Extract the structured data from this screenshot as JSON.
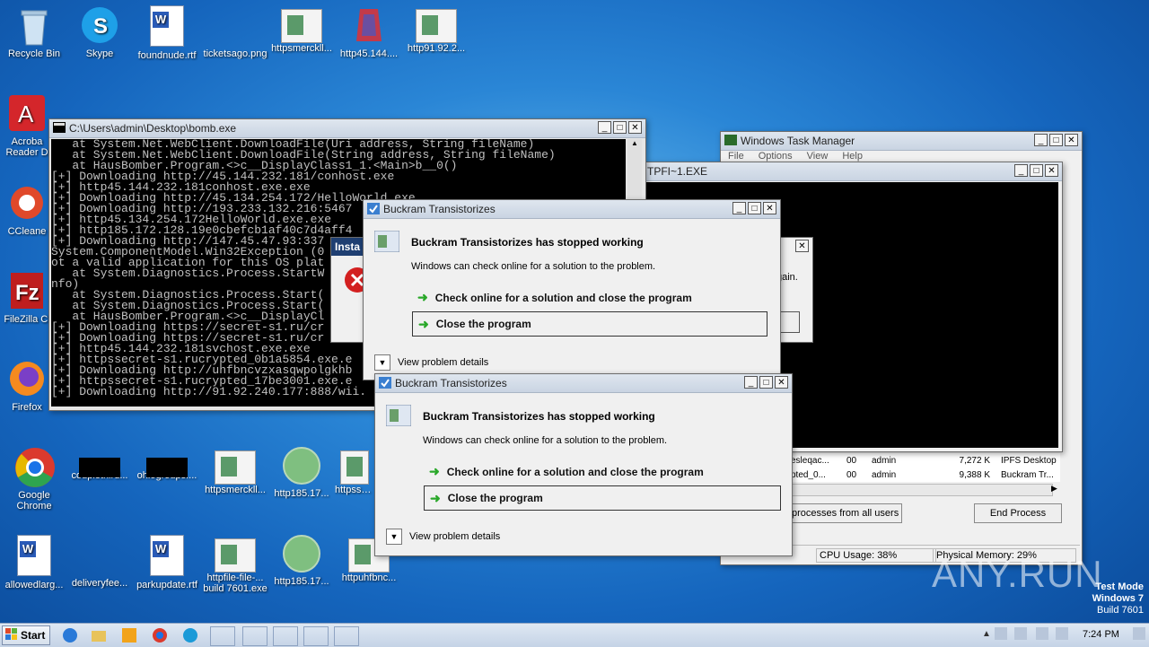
{
  "desktop": {
    "icons": [
      {
        "label": "Recycle Bin",
        "icon": "recycle-bin-icon"
      },
      {
        "label": "Skype",
        "icon": "skype-icon"
      },
      {
        "label": "foundnude.rtf",
        "icon": "word-document-icon"
      },
      {
        "label": "ticketsago.png",
        "icon": "image-file-icon"
      },
      {
        "label": "httpsmerckll...",
        "icon": "image-file-icon"
      },
      {
        "label": "http45.144....",
        "icon": "image-file-icon"
      },
      {
        "label": "http91.92.2...",
        "icon": "image-file-icon"
      },
      {
        "label": "Acroba Reader D",
        "icon": "acrobat-icon"
      },
      {
        "label": "CCleane",
        "icon": "ccleaner-icon"
      },
      {
        "label": "FileZilla Cl",
        "icon": "filezilla-icon"
      },
      {
        "label": "Firefox",
        "icon": "firefox-icon"
      },
      {
        "label": "Google Chrome",
        "icon": "chrome-icon"
      },
      {
        "label": "couplethird...",
        "icon": "image-file-icon"
      },
      {
        "label": "ohiogroups....",
        "icon": "image-file-icon"
      },
      {
        "label": "httpsmerckll...",
        "icon": "image-file-icon"
      },
      {
        "label": "http185.17...",
        "icon": "image-file-icon"
      },
      {
        "label": "httpsse...",
        "icon": "image-file-icon"
      },
      {
        "label": "allowedlarg...",
        "icon": "word-document-icon"
      },
      {
        "label": "deliveryfee...",
        "icon": "image-file-icon"
      },
      {
        "label": "parkupdate.rtf",
        "icon": "word-document-icon"
      },
      {
        "label": "httpfile-file-...",
        "icon": "image-file-icon"
      },
      {
        "label": "http185.17...",
        "icon": "image-file-icon"
      },
      {
        "label": "httpuhfbnc...",
        "icon": "image-file-icon"
      }
    ],
    "build_label": "build 7601.exe"
  },
  "console": {
    "title": "C:\\Users\\admin\\Desktop\\bomb.exe",
    "lines": [
      "   at System.Net.WebClient.DownloadFile(Uri address, String fileName)",
      "   at System.Net.WebClient.DownloadFile(String address, String fileName)",
      "   at HausBomber.Program.<>c__DisplayClass1_1.<Main>b__0()",
      "[+] Downloading http://45.144.232.181/conhost.exe",
      "[+] http45.144.232.181conhost.exe.exe",
      "[+] Downloading http://45.134.254.172/HelloWorld.exe",
      "[+] Downloading http://193.233.132.216:5467",
      "[+] http45.134.254.172HelloWorld.exe.exe",
      "[+] http185.172.128.19e0cbefcb1af40c7d4aff4",
      "[+] Downloading http://147.45.47.93:337",
      "System.ComponentModel.Win32Exception (0",
      "ot a valid application for this OS plat",
      "   at System.Diagnostics.Process.StartW",
      "nfo)",
      "   at System.Diagnostics.Process.Start(",
      "   at System.Diagnostics.Process.Start(",
      "   at HausBomber.Program.<>c__DisplayCl",
      "[+] Downloading https://secret-s1.ru/cr",
      "[+] Downloading https://secret-s1.ru/cr",
      "[+] http45.144.232.181svchost.exe.exe",
      "[+] httpssecret-s1.rucrypted_0b1a5854.exe.e",
      "[+] Downloading http://uhfbncvzxasqwpolgkhb",
      "[+] httpssecret-s1.rucrypted_17be3001.exe.e",
      "[+] Downloading http://91.92.240.177:888/wii."
    ]
  },
  "task_manager": {
    "title": "Windows Task Manager",
    "menu": [
      "File",
      "Options",
      "View",
      "Help"
    ],
    "rows": [
      {
        "name": "esleqac...",
        "cpu": "00",
        "user": "admin",
        "mem": "7,272 K",
        "desc": "IPFS Desktop"
      },
      {
        "name": "pted_0...",
        "cpu": "00",
        "user": "admin",
        "mem": "9,388 K",
        "desc": "Buckram Tr..."
      }
    ],
    "show_all_label": "processes from all users",
    "end_process_label": "End Process",
    "status_cpu": "CPU Usage: 38%",
    "status_mem": "Physical Memory: 29%"
  },
  "tpfi_window": {
    "title": "TPFI~1.EXE"
  },
  "install_dialog": {
    "title": "Insta",
    "text_partial": "gain."
  },
  "crash_dialogs": [
    {
      "title": "Buckram Transistorizes",
      "heading": "Buckram Transistorizes has stopped working",
      "subtext": "Windows can check online for a solution to the problem.",
      "option1": "Check online for a solution and close the program",
      "option2": "Close the program",
      "details": "View problem details"
    },
    {
      "title": "Buckram Transistorizes",
      "heading": "Buckram Transistorizes has stopped working",
      "subtext": "Windows can check online for a solution to the problem.",
      "option1": "Check online for a solution and close the program",
      "option2": "Close the program",
      "details": "View problem details"
    }
  ],
  "watermark": {
    "brand": "ANY.RUN",
    "test_mode": "Test Mode",
    "os": "Windows 7",
    "build": "Build 7601"
  },
  "taskbar": {
    "start_label": "Start",
    "clock": "7:24 PM"
  }
}
